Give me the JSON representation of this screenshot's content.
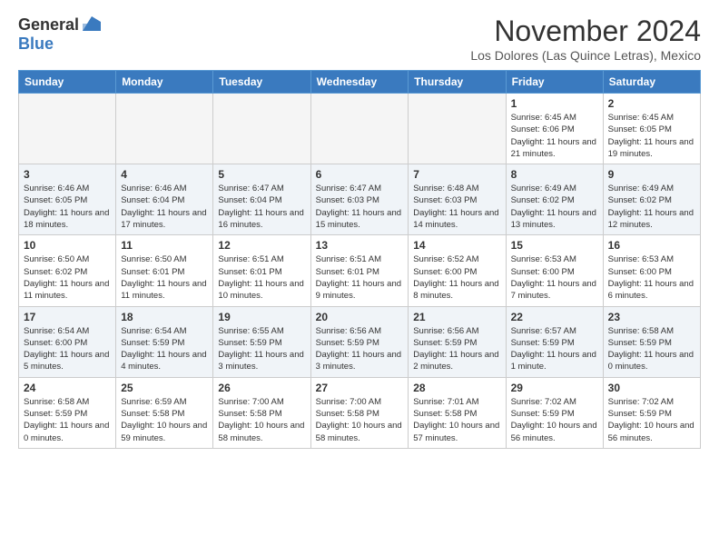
{
  "logo": {
    "general": "General",
    "blue": "Blue"
  },
  "title": "November 2024",
  "location": "Los Dolores (Las Quince Letras), Mexico",
  "days_of_week": [
    "Sunday",
    "Monday",
    "Tuesday",
    "Wednesday",
    "Thursday",
    "Friday",
    "Saturday"
  ],
  "weeks": [
    [
      {
        "day": "",
        "info": ""
      },
      {
        "day": "",
        "info": ""
      },
      {
        "day": "",
        "info": ""
      },
      {
        "day": "",
        "info": ""
      },
      {
        "day": "",
        "info": ""
      },
      {
        "day": "1",
        "info": "Sunrise: 6:45 AM\nSunset: 6:06 PM\nDaylight: 11 hours and 21 minutes."
      },
      {
        "day": "2",
        "info": "Sunrise: 6:45 AM\nSunset: 6:05 PM\nDaylight: 11 hours and 19 minutes."
      }
    ],
    [
      {
        "day": "3",
        "info": "Sunrise: 6:46 AM\nSunset: 6:05 PM\nDaylight: 11 hours and 18 minutes."
      },
      {
        "day": "4",
        "info": "Sunrise: 6:46 AM\nSunset: 6:04 PM\nDaylight: 11 hours and 17 minutes."
      },
      {
        "day": "5",
        "info": "Sunrise: 6:47 AM\nSunset: 6:04 PM\nDaylight: 11 hours and 16 minutes."
      },
      {
        "day": "6",
        "info": "Sunrise: 6:47 AM\nSunset: 6:03 PM\nDaylight: 11 hours and 15 minutes."
      },
      {
        "day": "7",
        "info": "Sunrise: 6:48 AM\nSunset: 6:03 PM\nDaylight: 11 hours and 14 minutes."
      },
      {
        "day": "8",
        "info": "Sunrise: 6:49 AM\nSunset: 6:02 PM\nDaylight: 11 hours and 13 minutes."
      },
      {
        "day": "9",
        "info": "Sunrise: 6:49 AM\nSunset: 6:02 PM\nDaylight: 11 hours and 12 minutes."
      }
    ],
    [
      {
        "day": "10",
        "info": "Sunrise: 6:50 AM\nSunset: 6:02 PM\nDaylight: 11 hours and 11 minutes."
      },
      {
        "day": "11",
        "info": "Sunrise: 6:50 AM\nSunset: 6:01 PM\nDaylight: 11 hours and 11 minutes."
      },
      {
        "day": "12",
        "info": "Sunrise: 6:51 AM\nSunset: 6:01 PM\nDaylight: 11 hours and 10 minutes."
      },
      {
        "day": "13",
        "info": "Sunrise: 6:51 AM\nSunset: 6:01 PM\nDaylight: 11 hours and 9 minutes."
      },
      {
        "day": "14",
        "info": "Sunrise: 6:52 AM\nSunset: 6:00 PM\nDaylight: 11 hours and 8 minutes."
      },
      {
        "day": "15",
        "info": "Sunrise: 6:53 AM\nSunset: 6:00 PM\nDaylight: 11 hours and 7 minutes."
      },
      {
        "day": "16",
        "info": "Sunrise: 6:53 AM\nSunset: 6:00 PM\nDaylight: 11 hours and 6 minutes."
      }
    ],
    [
      {
        "day": "17",
        "info": "Sunrise: 6:54 AM\nSunset: 6:00 PM\nDaylight: 11 hours and 5 minutes."
      },
      {
        "day": "18",
        "info": "Sunrise: 6:54 AM\nSunset: 5:59 PM\nDaylight: 11 hours and 4 minutes."
      },
      {
        "day": "19",
        "info": "Sunrise: 6:55 AM\nSunset: 5:59 PM\nDaylight: 11 hours and 3 minutes."
      },
      {
        "day": "20",
        "info": "Sunrise: 6:56 AM\nSunset: 5:59 PM\nDaylight: 11 hours and 3 minutes."
      },
      {
        "day": "21",
        "info": "Sunrise: 6:56 AM\nSunset: 5:59 PM\nDaylight: 11 hours and 2 minutes."
      },
      {
        "day": "22",
        "info": "Sunrise: 6:57 AM\nSunset: 5:59 PM\nDaylight: 11 hours and 1 minute."
      },
      {
        "day": "23",
        "info": "Sunrise: 6:58 AM\nSunset: 5:59 PM\nDaylight: 11 hours and 0 minutes."
      }
    ],
    [
      {
        "day": "24",
        "info": "Sunrise: 6:58 AM\nSunset: 5:59 PM\nDaylight: 11 hours and 0 minutes."
      },
      {
        "day": "25",
        "info": "Sunrise: 6:59 AM\nSunset: 5:58 PM\nDaylight: 10 hours and 59 minutes."
      },
      {
        "day": "26",
        "info": "Sunrise: 7:00 AM\nSunset: 5:58 PM\nDaylight: 10 hours and 58 minutes."
      },
      {
        "day": "27",
        "info": "Sunrise: 7:00 AM\nSunset: 5:58 PM\nDaylight: 10 hours and 58 minutes."
      },
      {
        "day": "28",
        "info": "Sunrise: 7:01 AM\nSunset: 5:58 PM\nDaylight: 10 hours and 57 minutes."
      },
      {
        "day": "29",
        "info": "Sunrise: 7:02 AM\nSunset: 5:59 PM\nDaylight: 10 hours and 56 minutes."
      },
      {
        "day": "30",
        "info": "Sunrise: 7:02 AM\nSunset: 5:59 PM\nDaylight: 10 hours and 56 minutes."
      }
    ]
  ]
}
